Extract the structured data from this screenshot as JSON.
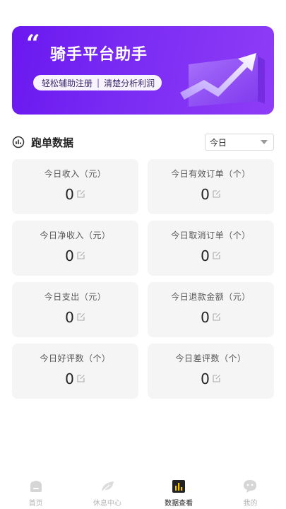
{
  "banner": {
    "quote_mark": "“",
    "title": "骑手平台助手",
    "subtitle_left": "轻松辅助注册",
    "subtitle_sep": "|",
    "subtitle_right": "清楚分析利润",
    "colors": {
      "gradient_start": "#6a18f0",
      "gradient_end": "#8e3cf6"
    }
  },
  "section": {
    "title": "跑单数据",
    "icon": "chart-circle-icon"
  },
  "date_select": {
    "value": "今日",
    "icon": "caret-down-icon"
  },
  "stats": [
    {
      "label": "今日收入（元）",
      "value": "0"
    },
    {
      "label": "今日有效订单（个）",
      "value": "0"
    },
    {
      "label": "今日净收入（元）",
      "value": "0"
    },
    {
      "label": "今日取消订单（个）",
      "value": "0"
    },
    {
      "label": "今日支出（元）",
      "value": "0"
    },
    {
      "label": "今日退款金额（元）",
      "value": "0"
    },
    {
      "label": "今日好评数（个）",
      "value": "0"
    },
    {
      "label": "今日差评数（个）",
      "value": "0"
    }
  ],
  "bottom_nav": [
    {
      "label": "首页",
      "icon": "home-icon",
      "active": false
    },
    {
      "label": "休息中心",
      "icon": "leaf-icon",
      "active": false
    },
    {
      "label": "数据查看",
      "icon": "bar-chart-icon",
      "active": true
    },
    {
      "label": "我的",
      "icon": "chat-bubble-icon",
      "active": false
    }
  ],
  "colors": {
    "card_bg": "#f5f5f6",
    "inactive_nav": "#b5b5b5",
    "active_nav": "#222222"
  }
}
